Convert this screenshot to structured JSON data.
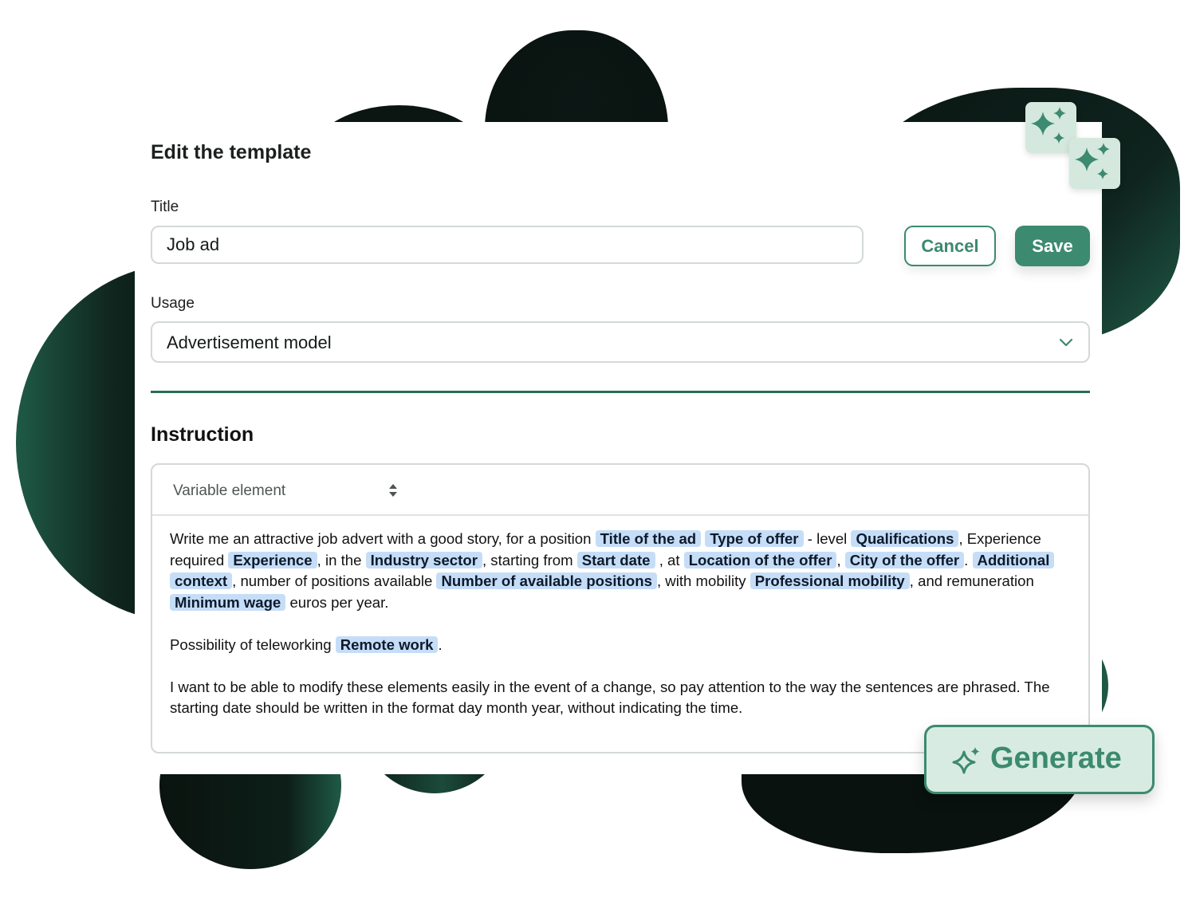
{
  "colors": {
    "accent": "#3c8a6f",
    "chip_bg": "#c5ddf7",
    "divider": "#2b6b55",
    "blob_dark": "#0b1512"
  },
  "page": {
    "heading": "Edit the template"
  },
  "title_field": {
    "label": "Title",
    "value": "Job ad"
  },
  "actions": {
    "cancel_label": "Cancel",
    "save_label": "Save"
  },
  "usage_field": {
    "label": "Usage",
    "value": "Advertisement model",
    "icon": "chevron-down-icon"
  },
  "instruction": {
    "heading": "Instruction",
    "variable_select": {
      "label": "Variable element",
      "icon": "up-down-arrows-icon"
    },
    "paragraph1": {
      "t1": "Write me an attractive job advert with a good story, for a position ",
      "v1": "Title of the ad",
      "t2": " ",
      "v2": "Type of offer",
      "t3": " - level ",
      "v3": "Qualifications",
      "t4": ", Experience required ",
      "v4": "Experience",
      "t5": ", in the ",
      "v5": "Industry sector",
      "t6": ", starting from ",
      "v6": "Start date",
      "t7": " , at ",
      "v7": "Location of the offer",
      "t8": ", ",
      "v8": "City of the offer",
      "t9": ". ",
      "v9": "Additional context",
      "t10": ", number of positions available ",
      "v10": "Number of available positions",
      "t11": ", with mobility ",
      "v11": "Professional mobility",
      "t12": ", and remuneration ",
      "v12": "Minimum wage",
      "t13": " euros per year."
    },
    "paragraph2": {
      "t1": "Possibility of teleworking ",
      "v1": "Remote work",
      "t2": "."
    },
    "paragraph3": "I want to be able to modify these elements easily in the event of a change, so pay attention to the way the sentences are phrased. The starting date should be written in the format day month year, without indicating the time."
  },
  "decorations": {
    "icon": "sparkles-icon"
  },
  "generate": {
    "label": "Generate",
    "icon": "sparkle-icon"
  }
}
